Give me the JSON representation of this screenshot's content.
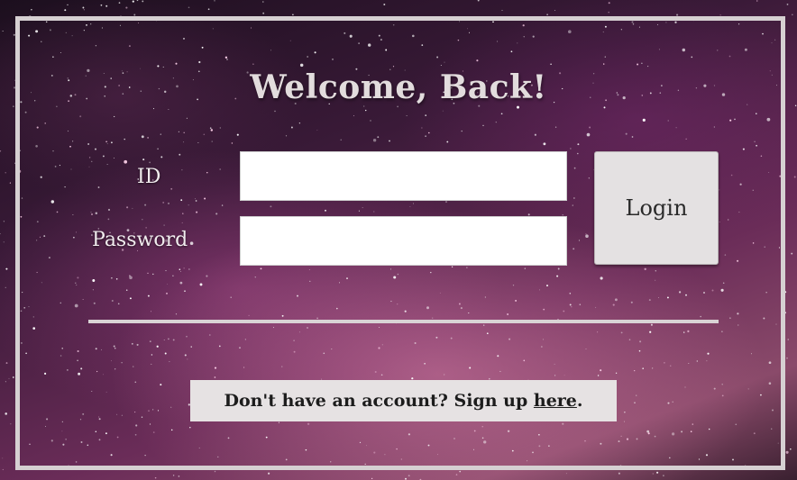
{
  "page": {
    "title": "Welcome, Back!"
  },
  "form": {
    "id_label": "ID",
    "id_value": "",
    "password_label": "Password",
    "password_value": "",
    "login_label": "Login"
  },
  "signup": {
    "prompt": "Don't have an account? Sign up ",
    "link_text": "here",
    "suffix": "."
  },
  "colors": {
    "frame": "#d6d0d2",
    "title": "#e2dcdd",
    "button_bg": "#e4e1e2",
    "signup_bg": "#e6e2e3"
  }
}
